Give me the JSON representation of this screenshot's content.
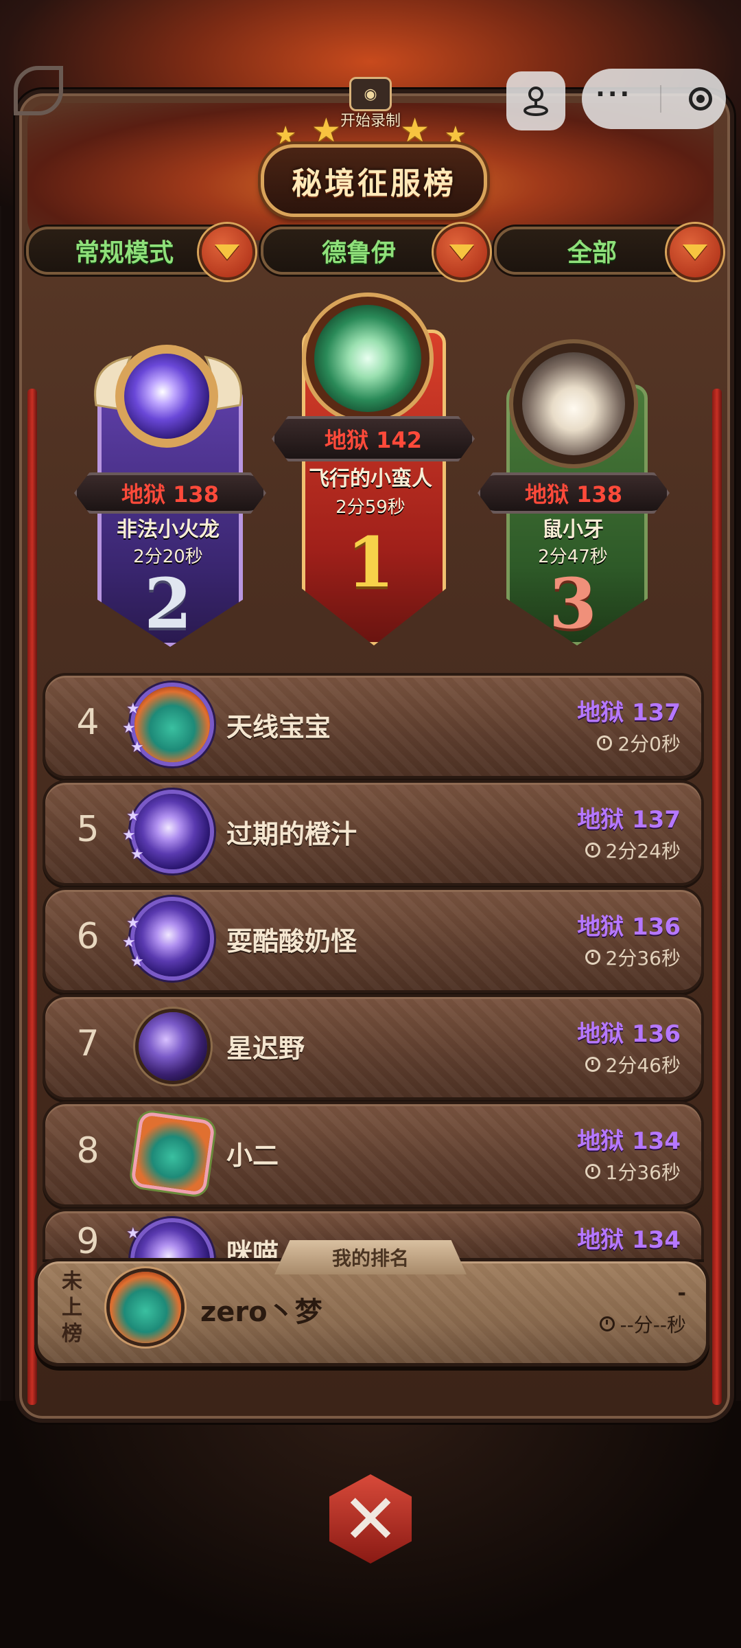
{
  "capsule": {
    "more_label": "···"
  },
  "header": {
    "record_label": "开始录制",
    "title": "秘境征服榜",
    "stars": 5
  },
  "filters": [
    {
      "label": "常规模式"
    },
    {
      "label": "德鲁伊"
    },
    {
      "label": "全部"
    }
  ],
  "podium": {
    "first": {
      "rank": "1",
      "level": "地狱 142",
      "name": "飞行的小蛮人",
      "time": "2分59秒"
    },
    "second": {
      "rank": "2",
      "level": "地狱 138",
      "name": "非法小火龙",
      "time": "2分20秒"
    },
    "third": {
      "rank": "3",
      "level": "地狱 138",
      "name": "鼠小牙",
      "time": "2分47秒"
    }
  },
  "list": [
    {
      "rank": "4",
      "name": "天线宝宝",
      "level": "地狱 137",
      "time": "2分0秒",
      "avatar": "dragon-icon"
    },
    {
      "rank": "5",
      "name": "过期的橙汁",
      "level": "地狱 137",
      "time": "2分24秒",
      "avatar": "moon-icon"
    },
    {
      "rank": "6",
      "name": "耍酷酸奶怪",
      "level": "地狱 136",
      "time": "2分36秒",
      "avatar": "moon-icon"
    },
    {
      "rank": "7",
      "name": "星迟野",
      "level": "地狱 136",
      "time": "2分46秒",
      "avatar": "swirl-icon"
    },
    {
      "rank": "8",
      "name": "小二",
      "level": "地狱 134",
      "time": "1分36秒",
      "avatar": "flower-dragon-icon"
    },
    {
      "rank": "9",
      "name": "咪喵",
      "level": "地狱 134",
      "time": "",
      "avatar": "moon-icon"
    }
  ],
  "my_rank": {
    "tag": "我的排名",
    "status": "未上榜",
    "name": "zero丶梦",
    "level": "-",
    "time": "--分--秒"
  },
  "colors": {
    "hell_red": "#ff4a3a",
    "score_purple": "#b678ff",
    "filter_green": "#8fe07a",
    "gold": "#f7c440"
  }
}
